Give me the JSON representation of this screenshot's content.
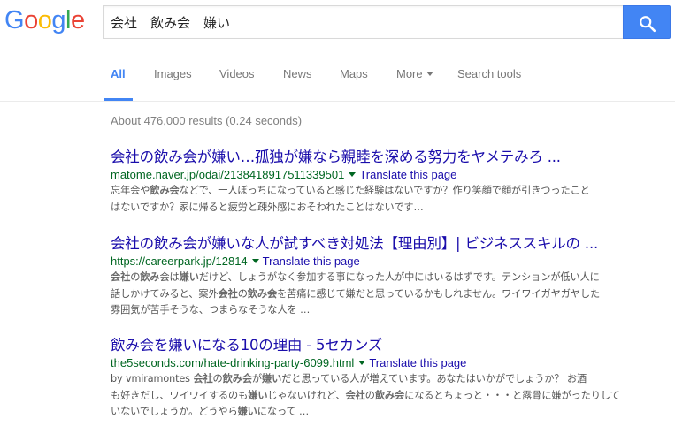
{
  "logo": {
    "text": "Google",
    "letters": [
      {
        "ch": "G",
        "color": "#4285f4"
      },
      {
        "ch": "o",
        "color": "#ea4335"
      },
      {
        "ch": "o",
        "color": "#fbbc05"
      },
      {
        "ch": "g",
        "color": "#4285f4"
      },
      {
        "ch": "l",
        "color": "#34a853"
      },
      {
        "ch": "e",
        "color": "#ea4335"
      }
    ]
  },
  "search": {
    "query": "会社　飲み会　嫌い",
    "button_icon": "search-icon"
  },
  "nav": {
    "tabs": [
      "All",
      "Images",
      "Videos",
      "News",
      "Maps",
      "More",
      "Search tools"
    ],
    "active": "All"
  },
  "stats": "About 476,000 results (0.24 seconds)",
  "results": [
    {
      "title": "会社の飲み会が嫌い…孤独が嫌なら親睦を深める努力をヤメテみろ ...",
      "url": "matome.naver.jp/odai/2138418917511339501",
      "translate": "Translate this page",
      "snippet": [
        [
          {
            "t": "忘年会や"
          },
          {
            "t": "飲み会",
            "b": true
          },
          {
            "t": "などで、一人ぼっちになっていると感じた経験はないですか？作り笑顔で顔が引きつったこと"
          }
        ],
        [
          {
            "t": "はないですか？家に帰ると疲労と疎外感におそわれたことはないです…"
          }
        ]
      ]
    },
    {
      "title": "会社の飲み会が嫌いな人が試すべき対処法【理由別】| ビジネススキルの ...",
      "url": "https://careerpark.jp/12814",
      "translate": "Translate this page",
      "snippet": [
        [
          {
            "t": "会社",
            "b": true
          },
          {
            "t": "の"
          },
          {
            "t": "飲み",
            "b": true
          },
          {
            "t": "会は"
          },
          {
            "t": "嫌い",
            "b": true
          },
          {
            "t": "だけど、しょうがなく参加する事になった人が中にはいるはずです。テンションが低い人に"
          }
        ],
        [
          {
            "t": "話しかけてみると、案外"
          },
          {
            "t": "会社",
            "b": true
          },
          {
            "t": "の"
          },
          {
            "t": "飲み会",
            "b": true
          },
          {
            "t": "を苦痛に感じて嫌だと思っているかもしれません。ワイワイガヤガヤした"
          }
        ],
        [
          {
            "t": "雰囲気が苦手そうな、つまらなそうな人を …"
          }
        ]
      ]
    },
    {
      "title": "飲み会を嫌いになる10の理由 - 5セカンズ",
      "url": "the5seconds.com/hate-drinking-party-6099.html",
      "translate": "Translate this page",
      "snippet": [
        [
          {
            "t": "by vmiramontes "
          },
          {
            "t": "会社",
            "b": true
          },
          {
            "t": "の"
          },
          {
            "t": "飲み会",
            "b": true
          },
          {
            "t": "が"
          },
          {
            "t": "嫌い",
            "b": true
          },
          {
            "t": "だと思っている人が増えています。あなたはいかがでしょうか？ お酒"
          }
        ],
        [
          {
            "t": "も好きだし、ワイワイするのも"
          },
          {
            "t": "嫌い",
            "b": true
          },
          {
            "t": "じゃないけれど、"
          },
          {
            "t": "会社",
            "b": true
          },
          {
            "t": "の"
          },
          {
            "t": "飲み会",
            "b": true
          },
          {
            "t": "になるとちょっと・・・と露骨に嫌がったりして"
          }
        ],
        [
          {
            "t": "いないでしょうか。どうやら"
          },
          {
            "t": "嫌い",
            "b": true
          },
          {
            "t": "になって …"
          }
        ]
      ]
    }
  ]
}
